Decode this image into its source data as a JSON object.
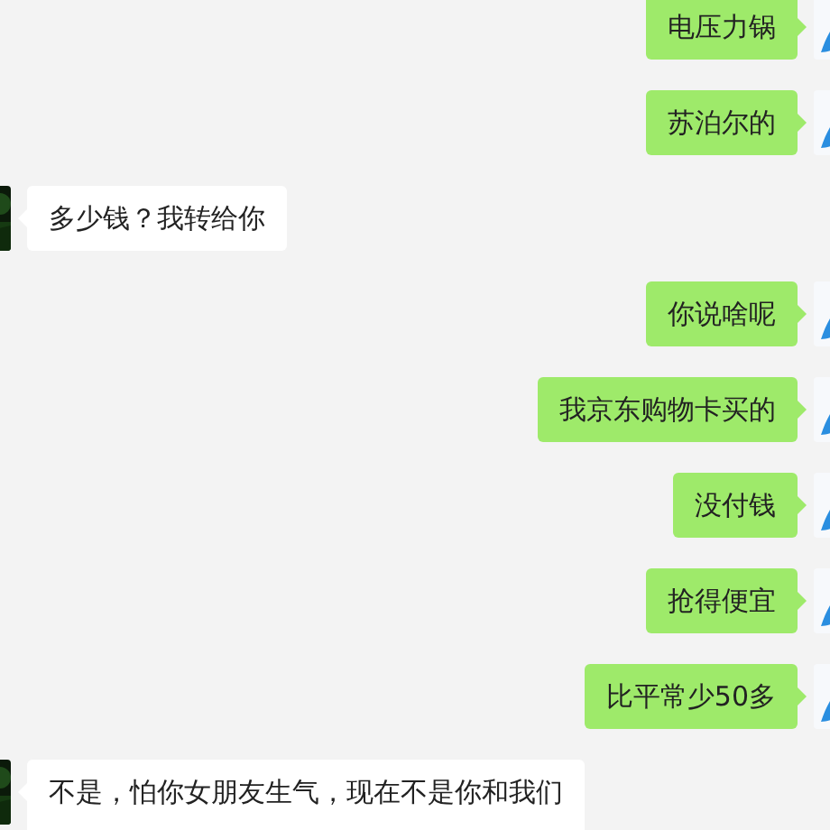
{
  "messages": [
    {
      "kind": "outgoing",
      "text": "电压力锅"
    },
    {
      "kind": "outgoing",
      "text": "苏泊尔的"
    },
    {
      "kind": "incoming",
      "text": "多少钱？我转给你"
    },
    {
      "kind": "outgoing",
      "text": "你说啥呢"
    },
    {
      "kind": "outgoing",
      "text": "我京东购物卡买的"
    },
    {
      "kind": "outgoing",
      "text": "没付钱"
    },
    {
      "kind": "outgoing",
      "text": "抢得便宜"
    },
    {
      "kind": "outgoing",
      "text": "比平常少50多"
    },
    {
      "kind": "incoming",
      "text": "不是，怕你女朋友生气，现在不是你和我们"
    }
  ]
}
